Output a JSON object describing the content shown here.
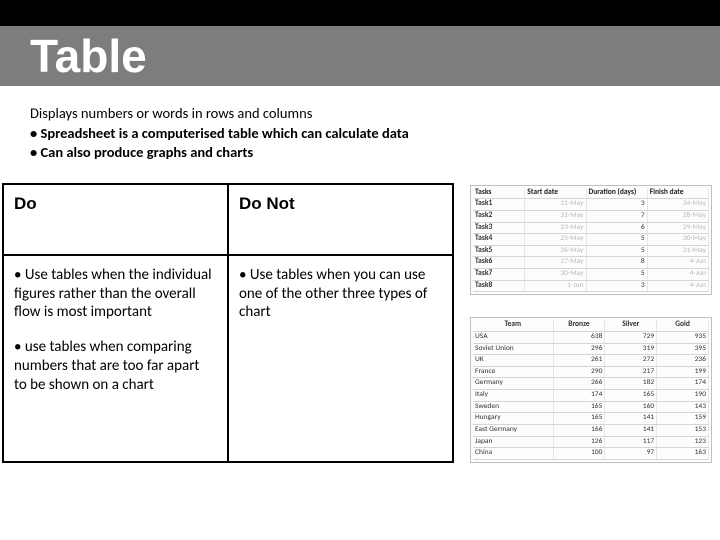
{
  "title": "Table",
  "intro": {
    "line1": "Displays numbers or words in rows and columns",
    "bullet1": "• Spreadsheet is a computerised table which can calculate data",
    "bullet2": "• Can also produce graphs and charts"
  },
  "guidelines": {
    "do_header": "Do",
    "donot_header": "Do Not",
    "do_1": "• Use tables when the individual figures rather than the overall flow is most important",
    "donot_1": "• Use tables when you can use one of the other three types of chart",
    "do_2": "• use tables when comparing numbers that are too far apart to be shown on a chart"
  },
  "task_table": {
    "headers": [
      "Tasks",
      "Start date",
      "Duration (days)",
      "Finish date"
    ],
    "rows": [
      [
        "Task1",
        "21-May",
        "3",
        "24-May"
      ],
      [
        "Task2",
        "21-May",
        "7",
        "28-May"
      ],
      [
        "Task3",
        "23-May",
        "6",
        "29-May"
      ],
      [
        "Task4",
        "25-May",
        "5",
        "30-May"
      ],
      [
        "Task5",
        "26-May",
        "5",
        "31-May"
      ],
      [
        "Task6",
        "27-May",
        "8",
        "4-Jun"
      ],
      [
        "Task7",
        "30-May",
        "5",
        "4-Jun"
      ],
      [
        "Task8",
        "1-Jun",
        "3",
        "4-Jun"
      ]
    ]
  },
  "country_table": {
    "headers": [
      "Team",
      "Bronze",
      "Silver",
      "Gold"
    ],
    "rows": [
      [
        "USA",
        "638",
        "729",
        "935"
      ],
      [
        "Soviet Union",
        "296",
        "319",
        "395"
      ],
      [
        "UK",
        "261",
        "272",
        "236"
      ],
      [
        "France",
        "290",
        "217",
        "199"
      ],
      [
        "Germany",
        "266",
        "182",
        "174"
      ],
      [
        "Italy",
        "174",
        "165",
        "190"
      ],
      [
        "Sweden",
        "165",
        "160",
        "143"
      ],
      [
        "Hungary",
        "165",
        "141",
        "159"
      ],
      [
        "East Germany",
        "166",
        "141",
        "153"
      ],
      [
        "Japan",
        "126",
        "117",
        "123"
      ],
      [
        "China",
        "100",
        "97",
        "163"
      ]
    ]
  }
}
